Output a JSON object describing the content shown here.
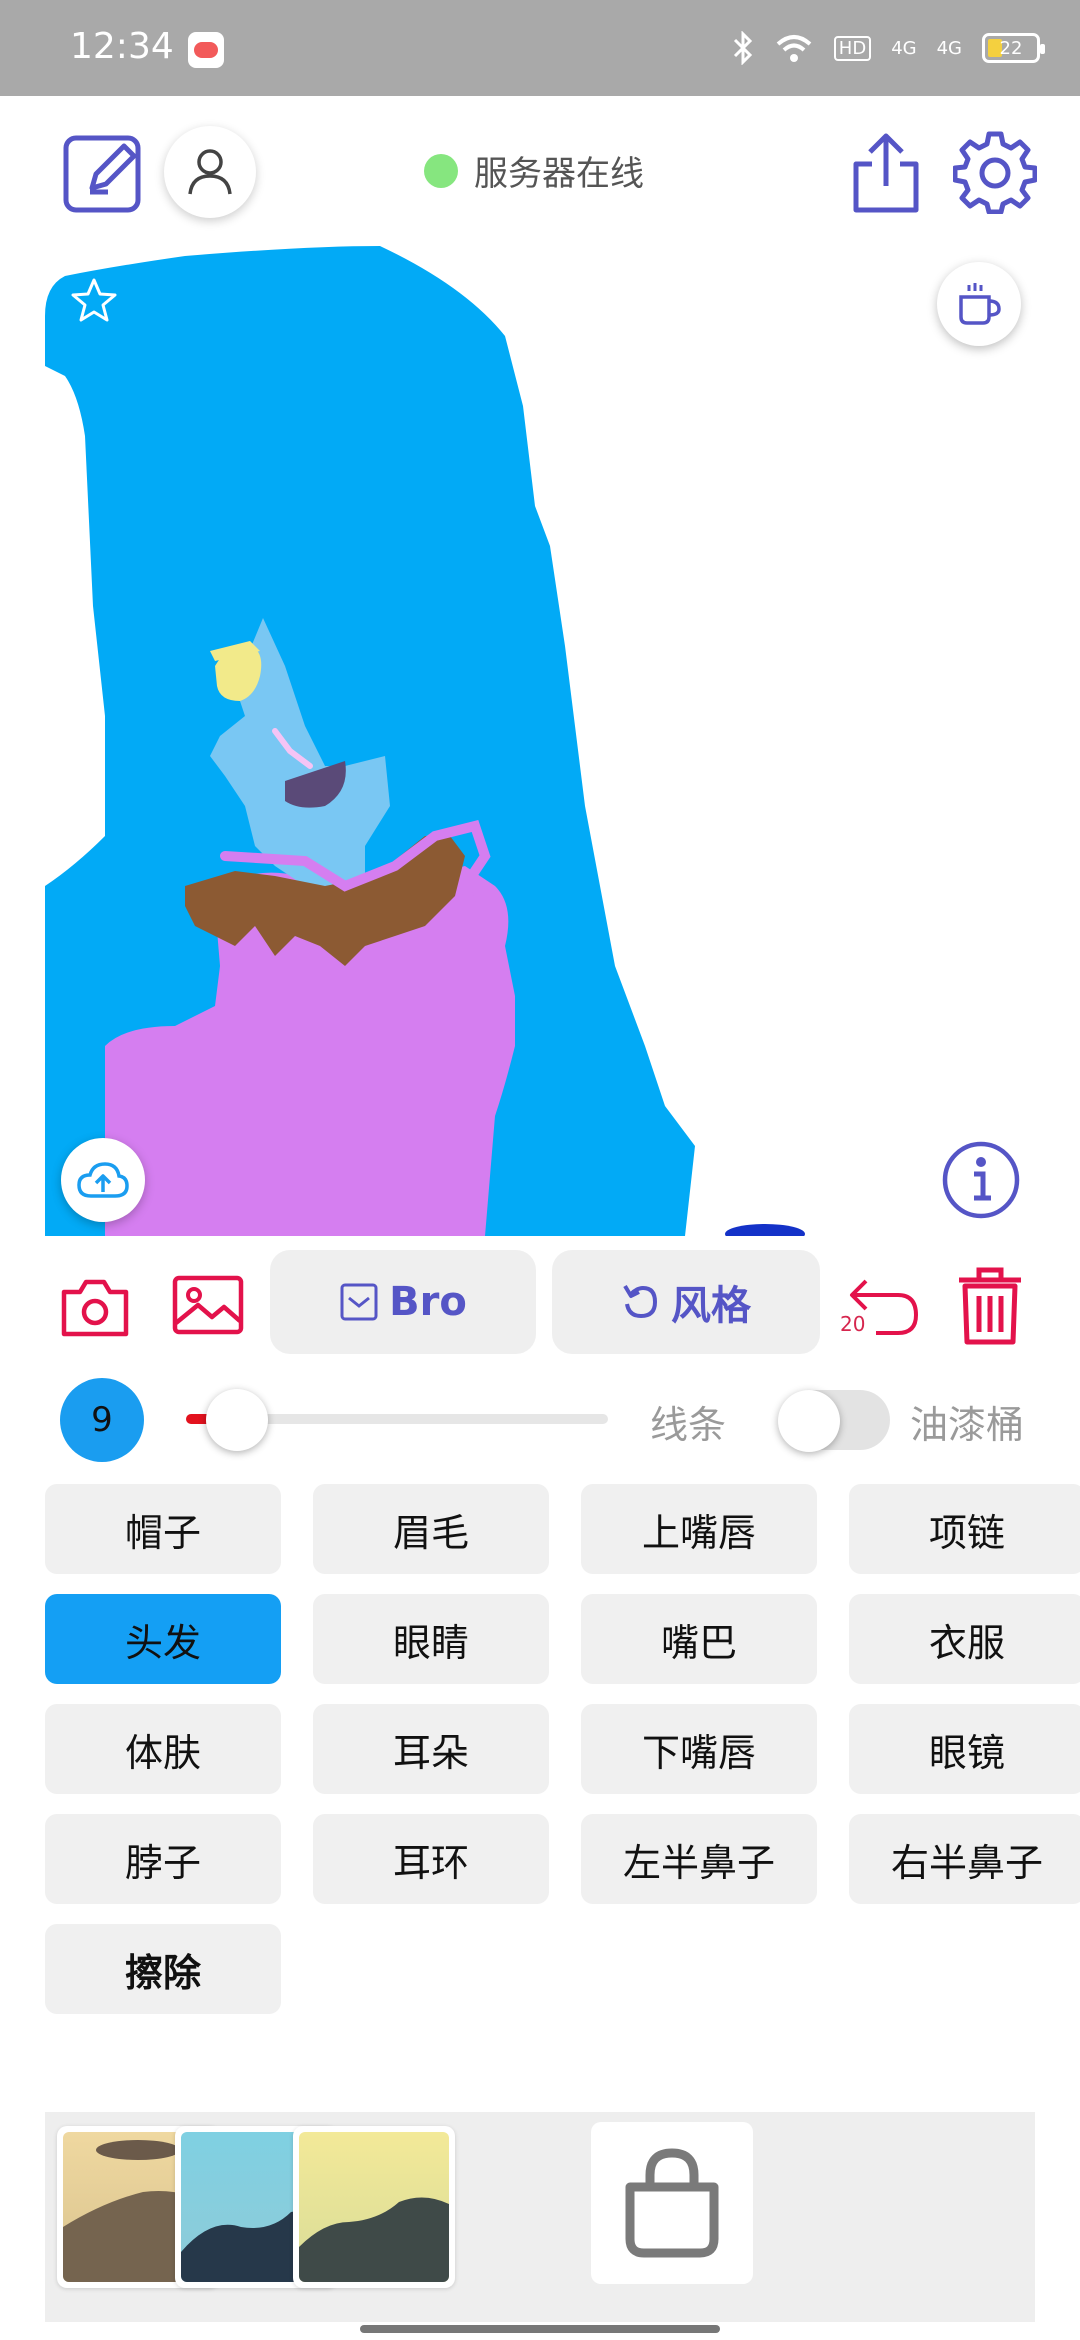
{
  "status_bar": {
    "time": "12:34",
    "hd_label": "HD",
    "signal_1": "4G",
    "signal_2": "4G",
    "battery": "22"
  },
  "header": {
    "server_status": "服务器在线",
    "status_color": "#86e67f"
  },
  "toolbar": {
    "model_label": "Bro",
    "style_label": "风格",
    "undo_count": "20"
  },
  "brush": {
    "size": "9",
    "slider_fraction": 0.04,
    "line_label": "线条",
    "bucket_label": "油漆桶",
    "bucket_enabled": false
  },
  "parts": [
    {
      "label": "帽子",
      "active": false
    },
    {
      "label": "眉毛",
      "active": false
    },
    {
      "label": "上嘴唇",
      "active": false
    },
    {
      "label": "项链",
      "active": false
    },
    {
      "label": "头发",
      "active": true
    },
    {
      "label": "眼睛",
      "active": false
    },
    {
      "label": "嘴巴",
      "active": false
    },
    {
      "label": "衣服",
      "active": false
    },
    {
      "label": "体肤",
      "active": false
    },
    {
      "label": "耳朵",
      "active": false
    },
    {
      "label": "下嘴唇",
      "active": false
    },
    {
      "label": "眼镜",
      "active": false
    },
    {
      "label": "脖子",
      "active": false
    },
    {
      "label": "耳环",
      "active": false
    },
    {
      "label": "左半鼻子",
      "active": false
    },
    {
      "label": "右半鼻子",
      "active": false
    },
    {
      "label": "擦除",
      "active": false,
      "bold": true
    }
  ],
  "colors": {
    "accent": "#5555c6",
    "danger": "#e3124b",
    "active_part": "#149ff4",
    "hair": "#02aaf6",
    "skin": "#79c7f3",
    "clothes": "#d57ef0",
    "necklace": "#8c5a33"
  },
  "icons": {
    "edit": "edit-icon",
    "user": "user-icon",
    "share": "share-icon",
    "settings": "gear-icon",
    "coffee": "coffee-icon",
    "star": "star-icon",
    "cloud_upload": "cloud-upload-icon",
    "info": "info-icon",
    "camera": "camera-icon",
    "image": "image-icon",
    "undo": "undo-icon",
    "trash": "trash-icon",
    "shop": "shopping-bag-icon"
  }
}
